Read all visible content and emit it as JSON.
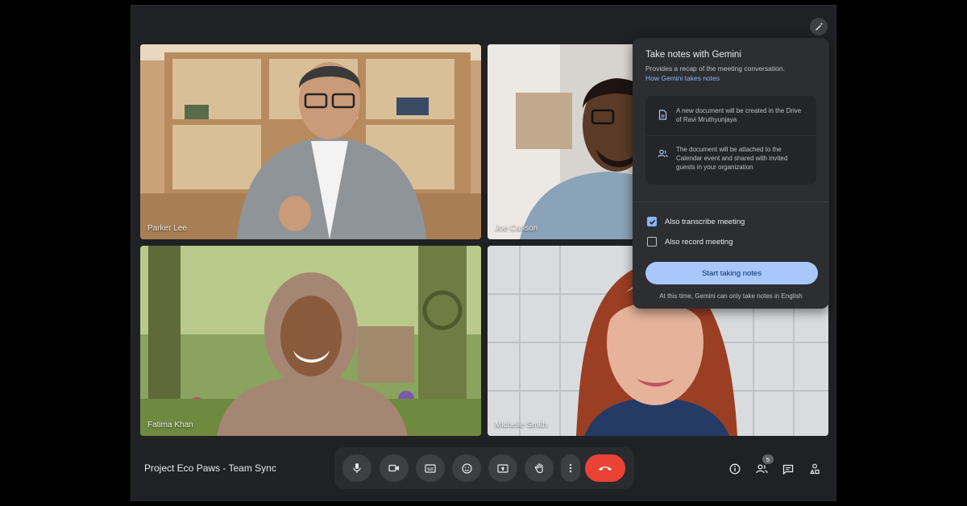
{
  "participants": [
    {
      "name": "Parker Lee"
    },
    {
      "name": "Joe Carlson"
    },
    {
      "name": "Fatima Khan"
    },
    {
      "name": "Michelle Smith"
    }
  ],
  "gemini_panel": {
    "title": "Take notes with Gemini",
    "description": "Provides a recap of the meeting conversation.",
    "link_text": "How Gemini takes notes",
    "info_rows": [
      {
        "icon": "document-icon",
        "text": "A new document will be created in the Drive of Ravi Mruthyunjaya"
      },
      {
        "icon": "people-share-icon",
        "text": "The document will be attached to the Calendar event and shared with invited guests in your organization"
      }
    ],
    "options": [
      {
        "label": "Also transcribe meeting",
        "checked": true
      },
      {
        "label": "Also record meeting",
        "checked": false
      }
    ],
    "start_button": "Start taking notes",
    "footer": "At this time, Gemini can only take notes in English"
  },
  "meeting": {
    "title": "Project Eco Paws - Team Sync",
    "participant_count": "5"
  },
  "controls": [
    "mic-icon",
    "camera-icon",
    "captions-icon",
    "emoji-icon",
    "present-icon",
    "raise-hand-icon",
    "more-options-icon",
    "hang-up-icon"
  ],
  "side_icons": [
    "info-icon",
    "people-icon",
    "chat-icon",
    "activities-icon"
  ],
  "colors": {
    "background": "#202124",
    "panel": "#2d2e31",
    "accent": "#8ab4f8",
    "button": "#a8c7fa",
    "hangup": "#ea4335"
  }
}
